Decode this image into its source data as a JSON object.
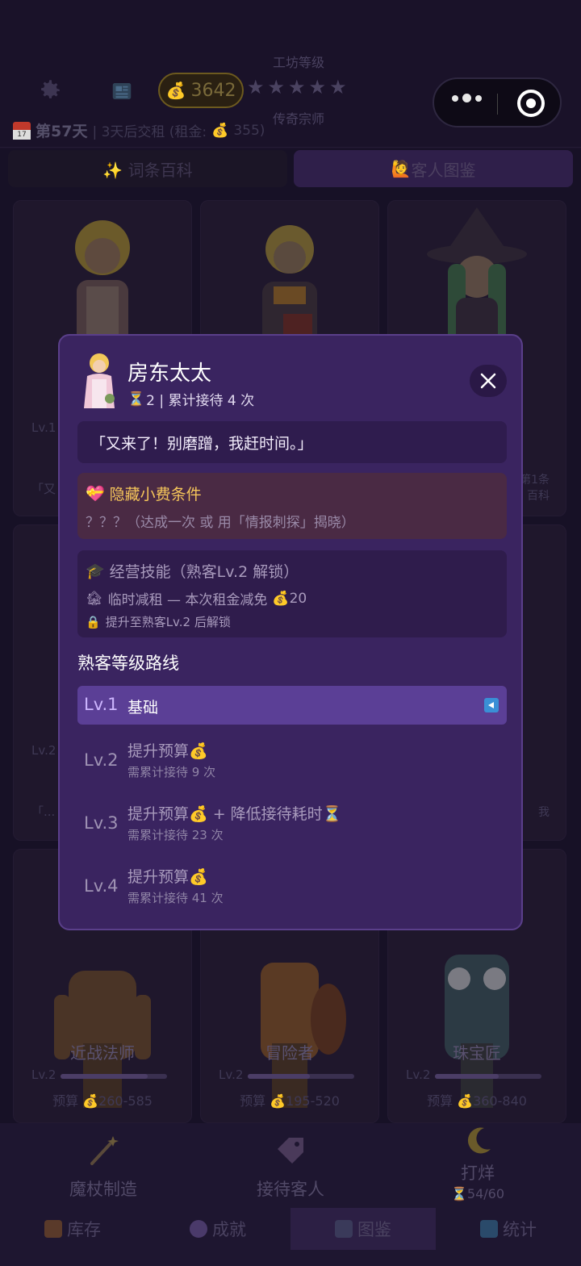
{
  "hud": {
    "gold": "3642",
    "workshop_level_title": "工坊等级",
    "workshop_rank": "传奇宗师",
    "day": "第57天",
    "rent_info": "| 3天后交租 (租金:",
    "rent_amount": "355)"
  },
  "tabs": [
    {
      "label": "✨ 词条百科"
    },
    {
      "label": "客人图鉴"
    }
  ],
  "bg_cards": [
    {
      "lv": "Lv.1",
      "quote": "「又"
    },
    {
      "lv": "Lv.2",
      "quote": "「..."
    },
    {
      "name": "近战法师",
      "lv": "Lv.2",
      "budget": "预算 💰260-585",
      "progress": 0.82
    },
    {
      "name": "冒险者",
      "lv": "Lv.2",
      "budget": "预算 💰195-520",
      "progress": 0.58
    },
    {
      "name": "珠宝匠",
      "lv": "Lv.2",
      "budget": "预算 💰360-840",
      "progress": 0.6
    }
  ],
  "bg_side_text": {
    "line1": "第1条",
    "line2": "百科",
    "tail": "我"
  },
  "modal": {
    "name": "房东太太",
    "meta": "2 | 累计接待 4 次",
    "quote": "「又来了！别磨蹭，我赶时间。」",
    "hidden": {
      "title": "隐藏小费条件",
      "desc": "？？？（达成一次 或 用「情报刺探」揭晓）"
    },
    "skill": {
      "title": "经营技能（熟客Lv.2 解锁）",
      "line": "临时减租 — 本次租金减免",
      "amount": "20",
      "lock": "提升至熟客Lv.2 后解锁"
    },
    "route_title": "熟客等级路线",
    "levels": [
      {
        "num": "Lv.1",
        "title": "基础",
        "need": ""
      },
      {
        "num": "Lv.2",
        "title": "提升预算💰",
        "need": "需累计接待 9 次"
      },
      {
        "num": "Lv.3",
        "title": "提升预算💰 + 降低接待耗时⏳",
        "need": "需累计接待 23 次"
      },
      {
        "num": "Lv.4",
        "title": "提升预算💰",
        "need": "需累计接待 41 次"
      }
    ]
  },
  "bottom": {
    "actions": [
      {
        "label": "魔杖制造"
      },
      {
        "label": "接待客人"
      },
      {
        "label": "打烊",
        "sub": "⏳54/60"
      }
    ],
    "tabs": [
      {
        "label": "库存"
      },
      {
        "label": "成就"
      },
      {
        "label": "图鉴"
      },
      {
        "label": "统计"
      }
    ]
  },
  "colors": {
    "accent": "#5b3f96",
    "modal_bg": "#3a2460",
    "gold": "#f6c65a"
  }
}
